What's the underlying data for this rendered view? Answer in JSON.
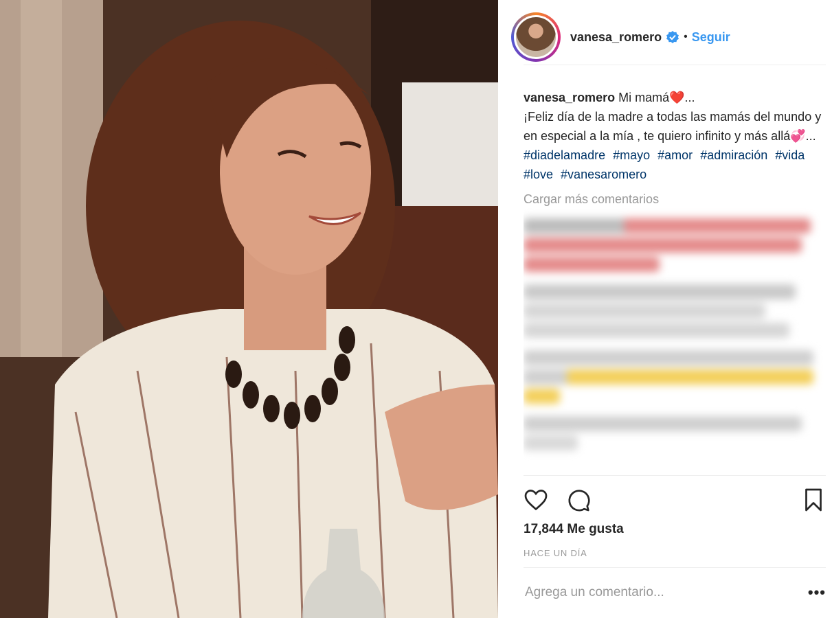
{
  "post": {
    "image_alt": "Fotografía antigua de una mujer sonriente con blusa a rayas y collar"
  },
  "header": {
    "username": "vanesa_romero",
    "verified_icon": "verified-badge-icon",
    "separator": "•",
    "follow_label": "Seguir"
  },
  "caption": {
    "username": "vanesa_romero",
    "line1": "Mi mamá❤️...",
    "line2": "¡Feliz día de la madre a todas las mamás del mundo y en especial a la mía , te quiero infinito y más allá💞...",
    "hashtags": [
      "#diadelamadre",
      "#mayo",
      "#amor",
      "#admiración",
      "#vida",
      "#love",
      "#vanesaromero"
    ]
  },
  "comments": {
    "load_more": "Cargar más comentarios"
  },
  "actions": {
    "like_icon": "heart-icon",
    "comment_icon": "comment-bubble-icon",
    "save_icon": "bookmark-icon"
  },
  "likes_text": "17,844 Me gusta",
  "timestamp": "HACE UN DÍA",
  "add_comment": {
    "placeholder": "Agrega un comentario...",
    "more_icon": "•••"
  },
  "colors": {
    "link": "#3897f0",
    "hashtag": "#003569",
    "muted": "#999999"
  }
}
